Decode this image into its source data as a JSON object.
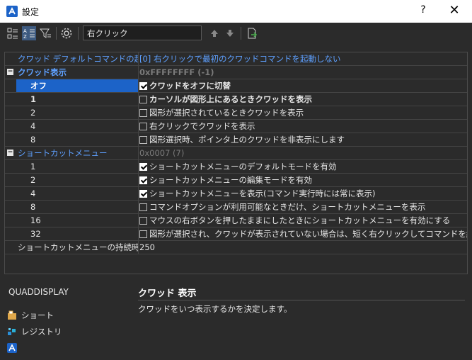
{
  "window": {
    "title": "設定",
    "help_label": "?",
    "close_label": "✕"
  },
  "toolbar": {
    "search_value": "右クリック",
    "buttons": [
      "categorized-view-icon",
      "alphabetical-view-icon",
      "filter-icon",
      "gear-icon",
      "arrow-up-icon",
      "arrow-down-icon",
      "export-icon"
    ]
  },
  "grid": {
    "rows": [
      {
        "kind": "header",
        "label": "クワッド デフォルトコマンドの起動",
        "value": "[0] 右クリックで最初のクワッドコマンドを起動しない"
      },
      {
        "kind": "group",
        "label": "クワッド表示",
        "value": "0xFFFFFFFF (-1)"
      },
      {
        "kind": "option",
        "label": "オフ",
        "value": "クワッドをオフに切替",
        "checked": true,
        "bold": true,
        "selected": true
      },
      {
        "kind": "option",
        "label": "1",
        "value": "カーソルが図形上にあるときクワッドを表示",
        "checked": false,
        "bold": true
      },
      {
        "kind": "option",
        "label": "2",
        "value": "図形が選択されているときクワッドを表示",
        "checked": false
      },
      {
        "kind": "option",
        "label": "4",
        "value": "右クリックでクワッドを表示",
        "checked": false
      },
      {
        "kind": "option",
        "label": "8",
        "value": "図形選択時、ポインタ上のクワッドを非表示にします",
        "checked": false
      },
      {
        "kind": "group",
        "label": "ショートカットメニュー",
        "value": "0x0007 (7)"
      },
      {
        "kind": "option",
        "label": "1",
        "value": "ショートカットメニューのデフォルトモードを有効",
        "checked": true
      },
      {
        "kind": "option",
        "label": "2",
        "value": "ショートカットメニューの編集モードを有効",
        "checked": true
      },
      {
        "kind": "option",
        "label": "4",
        "value": "ショートカットメニューを表示(コマンド実行時には常に表示)",
        "checked": true
      },
      {
        "kind": "option",
        "label": "8",
        "value": "コマンドオプションが利用可能なときだけ、ショートカットメニューを表示",
        "checked": false
      },
      {
        "kind": "option",
        "label": "16",
        "value": "マウスの右ボタンを押したままにしたときにショートカットメニューを有効にする",
        "checked": false
      },
      {
        "kind": "option",
        "label": "32",
        "value": "図形が選択され、クワッドが表示されていない場合は、短く右クリックしてコマンドを繰り返します",
        "checked": false
      },
      {
        "kind": "plain",
        "label": "ショートカットメニューの持続時間",
        "value": "250"
      }
    ]
  },
  "description": {
    "variable": "QUADDISPLAY",
    "title": "クワッド 表示",
    "text": "クワッドをいつ表示するかを決定します。"
  },
  "links": [
    {
      "label": "ショート",
      "icon": "shortcut-icon"
    },
    {
      "label": "レジストリ",
      "icon": "registry-icon"
    },
    {
      "label": "",
      "icon": "app-logo-icon"
    }
  ],
  "colors": {
    "accent": "#1c63c8",
    "link": "#5ea0ff"
  }
}
